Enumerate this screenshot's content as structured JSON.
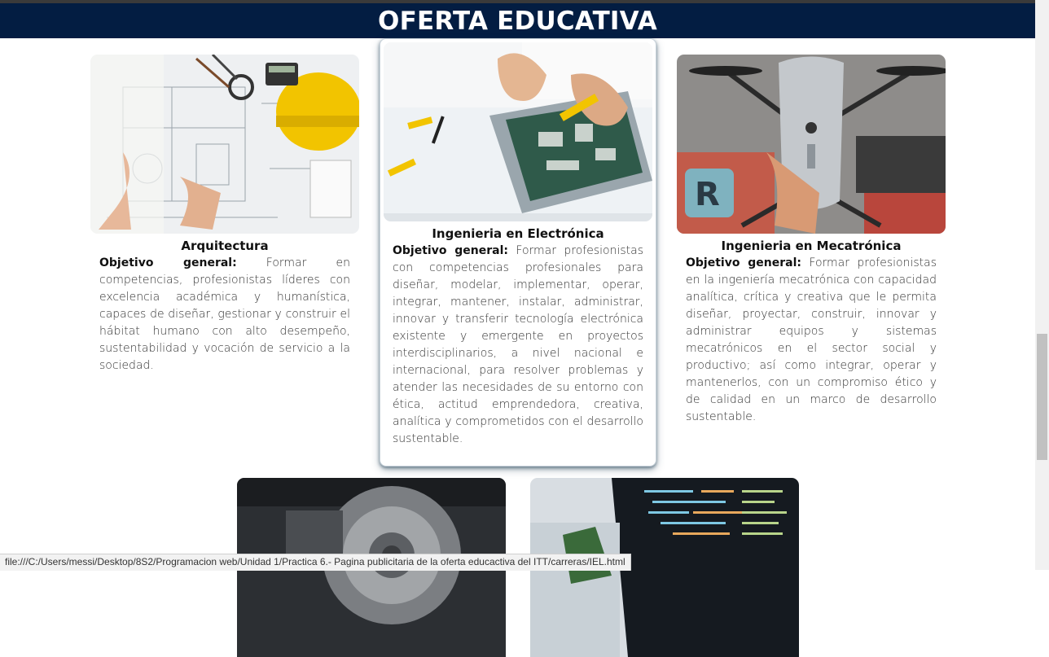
{
  "header": {
    "title": "OFERTA EDUCATIVA"
  },
  "cards": [
    {
      "image_desc": "architecture-plans-helmet",
      "title": "Arquitectura",
      "label": "Objetivo general:",
      "text": " Formar en competencias, profesionistas líderes con excelencia académica y humanística, capaces de diseñar, gestionar y construir el hábitat humano con alto desempeño, sustentabilidad y vocación de servicio a la sociedad."
    },
    {
      "image_desc": "electronics-circuit-board",
      "title": "Ingenieria en Electrónica",
      "label": "Objetivo general:",
      "text": " Formar profesionistas con competencias profesionales para diseñar, modelar, implementar, operar, integrar, mantener, instalar, administrar, innovar y transferir tecnología electrónica existente y emergente en proyectos interdisciplinarios, a nivel nacional e internacional, para resolver problemas y atender las necesidades de su entorno con ética, actitud emprendedora, creativa, analítica y comprometidos con el desarrollo sustentable."
    },
    {
      "image_desc": "drone",
      "title": "Ingenieria en Mecatrónica",
      "label": "Objetivo general:",
      "text": " Formar profesionistas en la ingeniería mecatrónica con capacidad analítica, crítica y creativa que le permita diseñar, proyectar, construir, innovar y administrar equipos y sistemas mecatrónicos en el sector social y productivo; así como integrar, operar y mantenerlos, con un compromiso ético y de calidad en un marco de desarrollo sustentable."
    }
  ],
  "status_bar": {
    "url": "file:///C:/Users/messi/Desktop/8S2/Programacion web/Unidad 1/Practica 6.- Pagina publicitaria de la oferta educactiva del ITT/carreras/IEL.html"
  }
}
